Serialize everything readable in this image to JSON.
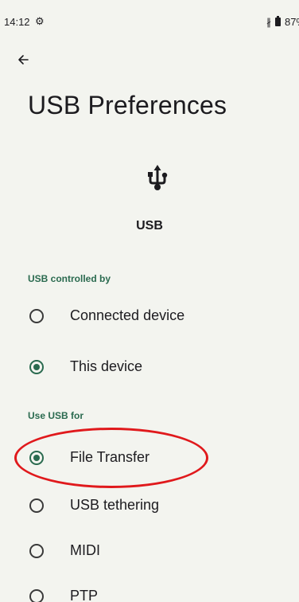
{
  "status_bar": {
    "time": "14:12",
    "battery_text": "87%"
  },
  "header": {
    "title": "USB Preferences"
  },
  "device": {
    "label": "USB"
  },
  "sections": {
    "controlled_by": {
      "header": "USB controlled by",
      "options": [
        {
          "label": "Connected device",
          "selected": false
        },
        {
          "label": "This device",
          "selected": true
        }
      ]
    },
    "use_usb_for": {
      "header": "Use USB for",
      "options": [
        {
          "label": "File Transfer",
          "selected": true
        },
        {
          "label": "USB tethering",
          "selected": false
        },
        {
          "label": "MIDI",
          "selected": false
        },
        {
          "label": "PTP",
          "selected": false
        }
      ]
    }
  },
  "colors": {
    "accent": "#2a6a4f",
    "background": "#f3f4ef",
    "annotation": "#e0191c"
  },
  "icons": {
    "back": "arrow-back-icon",
    "usb": "usb-icon",
    "settings": "gear-icon",
    "bluetooth": "bluetooth-icon",
    "battery": "battery-icon"
  }
}
